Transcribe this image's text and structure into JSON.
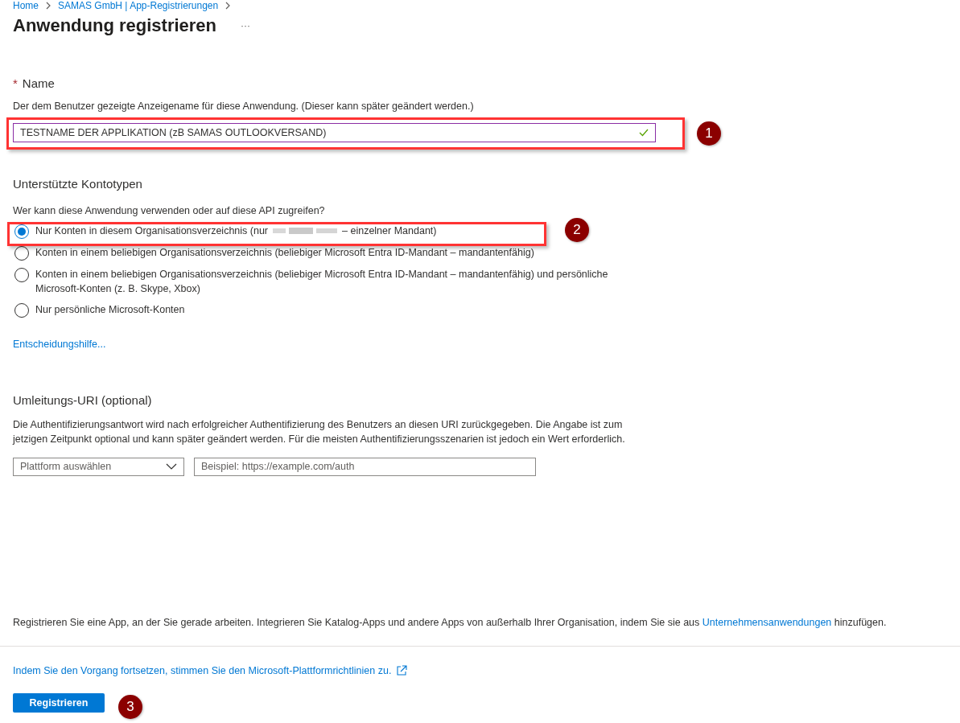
{
  "breadcrumb": [
    {
      "label": "Home"
    },
    {
      "label": "SAMAS GmbH | App-Registrierungen"
    }
  ],
  "title": "Anwendung registrieren",
  "more_menu": "···",
  "name_section": {
    "required_mark": "*",
    "label": "Name",
    "description": "Der dem Benutzer gezeigte Anzeigename für diese Anwendung. (Dieser kann später geändert werden.)",
    "value": "TESTNAME DER APPLIKATION (zB SAMAS OUTLOOKVERSAND)",
    "valid": true
  },
  "account_types": {
    "heading": "Unterstützte Kontotypen",
    "question": "Wer kann diese Anwendung verwenden oder auf diese API zugreifen?",
    "options": [
      {
        "label": "Nur Konten in diesem Organisationsverzeichnis (nur",
        "redacted": true,
        "label_after": "– einzelner Mandant)",
        "selected": true
      },
      {
        "label": "Konten in einem beliebigen Organisationsverzeichnis (beliebiger Microsoft Entra ID-Mandant – mandantenfähig)",
        "redacted": false,
        "selected": false
      },
      {
        "label": "Konten in einem beliebigen Organisationsverzeichnis (beliebiger Microsoft Entra ID-Mandant – mandantenfähig) und persönliche Microsoft-Konten (z. B. Skype, Xbox)",
        "redacted": false,
        "selected": false
      },
      {
        "label": "Nur persönliche Microsoft-Konten",
        "redacted": false,
        "selected": false
      }
    ],
    "help_link": "Entscheidungshilfe..."
  },
  "redirect": {
    "heading": "Umleitungs-URI (optional)",
    "description": "Die Authentifizierungsantwort wird nach erfolgreicher Authentifizierung des Benutzers an diesen URI zurückgegeben. Die Angabe ist zum jetzigen Zeitpunkt optional und kann später geändert werden. Für die meisten Authentifizierungsszenarien ist jedoch ein Wert erforderlich.",
    "platform_placeholder": "Plattform auswählen",
    "uri_placeholder": "Beispiel: https://example.com/auth"
  },
  "footer": {
    "info_before": "Registrieren Sie eine App, an der Sie gerade arbeiten. Integrieren Sie Katalog-Apps und andere Apps von außerhalb Ihrer Organisation, indem Sie sie aus ",
    "info_link": "Unternehmensanwendungen",
    "info_after": " hinzufügen.",
    "policy_link": "Indem Sie den Vorgang fortsetzen, stimmen Sie den Microsoft-Plattformrichtlinien zu.",
    "register_button": "Registrieren"
  },
  "annotations": [
    {
      "number": "1"
    },
    {
      "number": "2"
    },
    {
      "number": "3"
    }
  ]
}
